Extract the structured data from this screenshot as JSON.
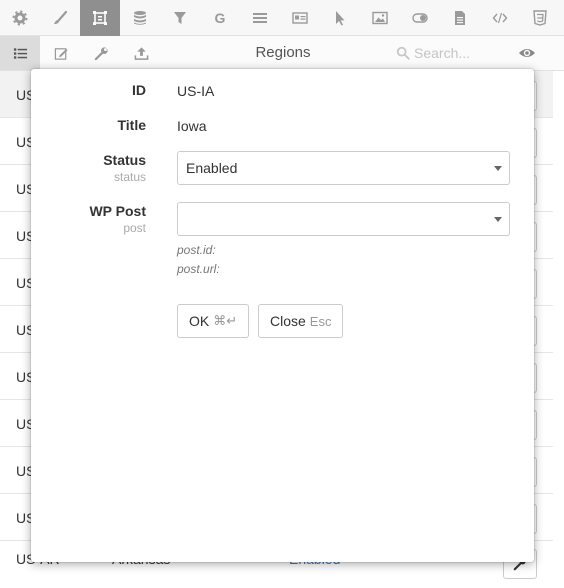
{
  "toolbar": {
    "icons": [
      "gear-icon",
      "brush-icon",
      "region-icon",
      "database-icon",
      "filter-icon",
      "g-icon",
      "list-icon",
      "card-icon",
      "pointer-icon",
      "image-icon",
      "toggle-icon",
      "document-icon",
      "code-icon",
      "css-icon"
    ],
    "active": "region-icon"
  },
  "subbar": {
    "title": "Regions",
    "search_placeholder": "Search..."
  },
  "list": {
    "rows": [
      {
        "id": "US"
      },
      {
        "id": "US"
      },
      {
        "id": "US"
      },
      {
        "id": "US"
      },
      {
        "id": "US"
      },
      {
        "id": "US"
      },
      {
        "id": "US"
      },
      {
        "id": "US"
      },
      {
        "id": "US"
      },
      {
        "id": "US"
      }
    ],
    "last_row": {
      "id": "US-AR",
      "title": "Arkansas",
      "status": "Enabled ·"
    }
  },
  "modal": {
    "id_label": "ID",
    "id_value": "US-IA",
    "title_label": "Title",
    "title_value": "Iowa",
    "status_label": "Status",
    "status_sublabel": "status",
    "status_value": "Enabled",
    "wp_post_label": "WP Post",
    "wp_post_sublabel": "post",
    "wp_post_value": "",
    "post_id_note": "post.id:",
    "post_url_note": "post.url:",
    "ok_label": "OK",
    "ok_shortcut": "⌘↵",
    "close_label": "Close",
    "close_shortcut": "Esc"
  }
}
